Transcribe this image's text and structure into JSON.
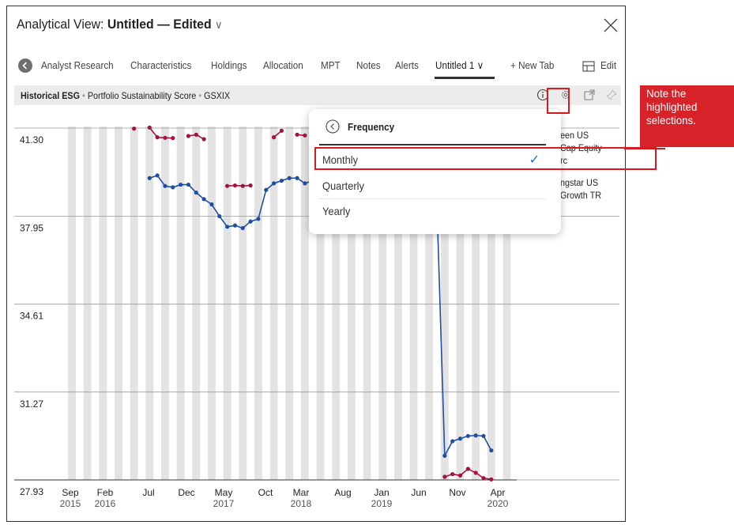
{
  "window": {
    "title_prefix": "Analytical View:",
    "title_doc": "Untitled",
    "title_dash": "—",
    "title_state": "Edited",
    "title_chevron": "∨"
  },
  "tabs": {
    "items": [
      {
        "label": "Analyst Research"
      },
      {
        "label": "Characteristics"
      },
      {
        "label": "Holdings"
      },
      {
        "label": "Allocation"
      },
      {
        "label": "MPT"
      },
      {
        "label": "Notes"
      },
      {
        "label": "Alerts"
      },
      {
        "label": "Untitled 1 ∨",
        "active": true
      }
    ],
    "new_tab_label": "+  New Tab",
    "edit_label": "Edit"
  },
  "widget": {
    "title": "Historical ESG",
    "bullet": "•",
    "subtitle_1": "Portfolio Sustainability Score",
    "subtitle_2": "GSXIX",
    "icons": [
      "info-icon",
      "gear-icon",
      "popout-icon",
      "pin-icon"
    ]
  },
  "legend": {
    "series_1_lines": [
      "een US",
      "Cap Equity",
      "rc"
    ],
    "series_2_lines": [
      "ngstar US",
      "Growth TR"
    ]
  },
  "frequency_menu": {
    "title": "Frequency",
    "options": [
      {
        "label": "Monthly",
        "selected": true,
        "check": "✓"
      },
      {
        "label": "Quarterly",
        "selected": false
      },
      {
        "label": "Yearly",
        "selected": false
      }
    ]
  },
  "callout": {
    "text": "Note the highlighted selections."
  },
  "colors": {
    "series_1": "#1f4fa3",
    "series_2": "#a5123f",
    "highlight": "#d71920",
    "stripe": "#e3e3e3",
    "check": "#1f6fd2"
  },
  "chart_data": {
    "type": "line",
    "y_ticks": [
      "41.30",
      "37.95",
      "34.61",
      "31.27",
      "27.93"
    ],
    "ylim": [
      27.93,
      41.3
    ],
    "x_labels": [
      {
        "month": "Sep",
        "year": "2015"
      },
      {
        "month": "Feb",
        "year": "2016"
      },
      {
        "month": "Jul",
        "year": ""
      },
      {
        "month": "Dec",
        "year": ""
      },
      {
        "month": "May",
        "year": "2017"
      },
      {
        "month": "Oct",
        "year": ""
      },
      {
        "month": "Mar",
        "year": "2018"
      },
      {
        "month": "Aug",
        "year": ""
      },
      {
        "month": "Jan",
        "year": "2019"
      },
      {
        "month": "Jun",
        "year": ""
      },
      {
        "month": "Nov",
        "year": ""
      },
      {
        "month": "Apr",
        "year": "2020"
      }
    ],
    "grid_stripes": true,
    "series": [
      {
        "color_key": "series_1",
        "points": [
          {
            "m": 10,
            "v": 39.4
          },
          {
            "m": 11,
            "v": 39.5
          },
          {
            "m": 12,
            "v": 39.1
          },
          {
            "m": 13,
            "v": 39.05
          },
          {
            "m": 14,
            "v": 39.15
          },
          {
            "m": 15,
            "v": 39.15
          },
          {
            "m": 16,
            "v": 38.85
          },
          {
            "m": 17,
            "v": 38.6
          },
          {
            "m": 18,
            "v": 38.4
          },
          {
            "m": 19,
            "v": 37.95
          },
          {
            "m": 20,
            "v": 37.55
          },
          {
            "m": 21,
            "v": 37.6
          },
          {
            "m": 22,
            "v": 37.5
          },
          {
            "m": 23,
            "v": 37.75
          },
          {
            "m": 24,
            "v": 37.85
          },
          {
            "m": 25,
            "v": 38.95
          },
          {
            "m": 26,
            "v": 39.2
          },
          {
            "m": 27,
            "v": 39.3
          },
          {
            "m": 28,
            "v": 39.4
          },
          {
            "m": 29,
            "v": 39.4
          },
          {
            "m": 30,
            "v": 39.2
          },
          {
            "m": 31,
            "v": 39.3
          },
          {
            "m": 47,
            "v": 38.4
          },
          {
            "m": 48,
            "v": 28.85
          },
          {
            "m": 49,
            "v": 29.4
          },
          {
            "m": 50,
            "v": 29.5
          },
          {
            "m": 51,
            "v": 29.6
          },
          {
            "m": 52,
            "v": 29.62
          },
          {
            "m": 53,
            "v": 29.6
          },
          {
            "m": 54,
            "v": 29.05
          }
        ]
      },
      {
        "color_key": "series_2",
        "segments": [
          [
            {
              "m": 8,
              "v": 41.28
            }
          ],
          [
            {
              "m": 10,
              "v": 41.32
            },
            {
              "m": 11,
              "v": 40.95
            },
            {
              "m": 12,
              "v": 40.93
            },
            {
              "m": 13,
              "v": 40.92
            }
          ],
          [
            {
              "m": 15,
              "v": 41.0
            },
            {
              "m": 16,
              "v": 41.05
            },
            {
              "m": 17,
              "v": 40.88
            }
          ],
          [
            {
              "m": 20,
              "v": 39.1
            },
            {
              "m": 21,
              "v": 39.12
            },
            {
              "m": 22,
              "v": 39.1
            },
            {
              "m": 23,
              "v": 39.12
            }
          ],
          [
            {
              "m": 26,
              "v": 40.95
            },
            {
              "m": 27,
              "v": 41.2
            }
          ],
          [
            {
              "m": 29,
              "v": 41.05
            },
            {
              "m": 30,
              "v": 41.02
            }
          ],
          [
            {
              "m": 48,
              "v": 28.05
            },
            {
              "m": 49,
              "v": 28.15
            },
            {
              "m": 50,
              "v": 28.1
            },
            {
              "m": 51,
              "v": 28.35
            },
            {
              "m": 52,
              "v": 28.2
            },
            {
              "m": 53,
              "v": 28.0
            },
            {
              "m": 54,
              "v": 27.95
            }
          ]
        ]
      }
    ]
  }
}
